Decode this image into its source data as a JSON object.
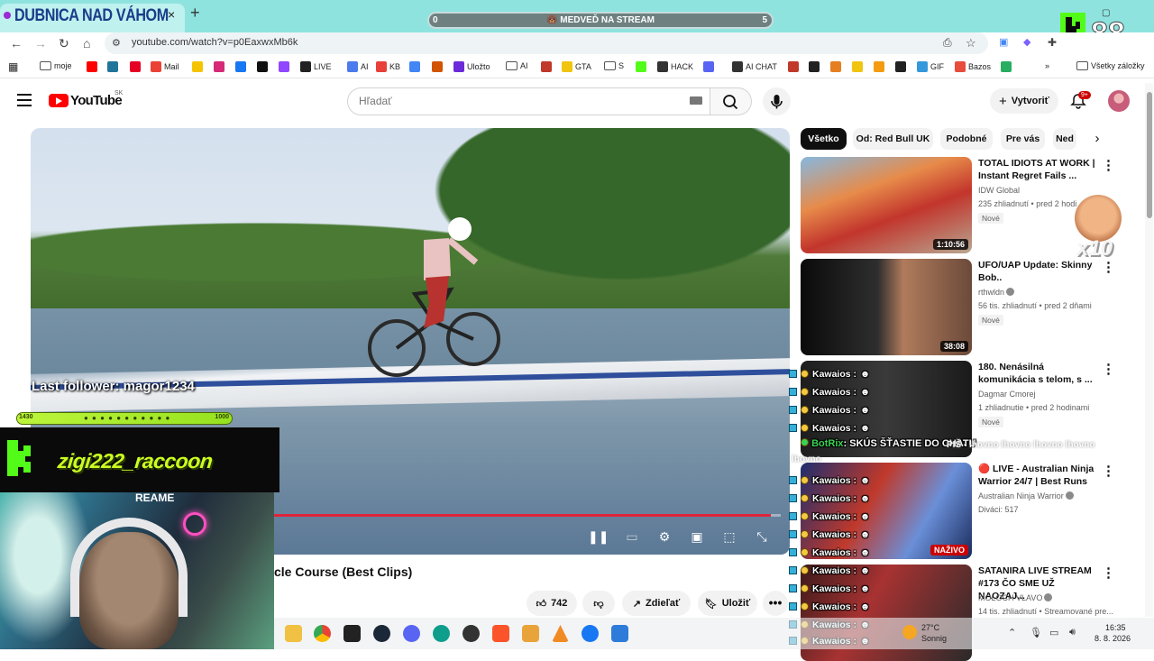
{
  "browser": {
    "tab_title": "DUBNICA NAD VÁHOM",
    "tab_close": "×",
    "new_tab": "+",
    "url": "youtube.com/watch?v=p0EaxwxMb6k",
    "stream_overlay": {
      "left": "0",
      "center": "🐻 MEDVEĎ NA STREAM",
      "right": "5"
    },
    "bookmarks": [
      {
        "label": "moje",
        "icon": "folder-icon",
        "color": "#555555"
      },
      {
        "label": "",
        "icon": "youtube-icon",
        "color": "#ff0000"
      },
      {
        "label": "",
        "icon": "wordpress-icon",
        "color": "#21759b"
      },
      {
        "label": "",
        "icon": "pinterest-icon",
        "color": "#e60023"
      },
      {
        "label": "Mail",
        "icon": "gmail-icon",
        "color": "#ea4335"
      },
      {
        "label": "",
        "icon": "bulb-icon",
        "color": "#f5c400"
      },
      {
        "label": "",
        "icon": "instagram-icon",
        "color": "#d62976"
      },
      {
        "label": "",
        "icon": "facebook-icon",
        "color": "#1877f2"
      },
      {
        "label": "",
        "icon": "tiktok-icon",
        "color": "#111111"
      },
      {
        "label": "",
        "icon": "twitch-icon",
        "color": "#9146ff"
      },
      {
        "label": "LIVE",
        "icon": "live-icon",
        "color": "#222222"
      },
      {
        "label": "AI",
        "icon": "gemini-icon",
        "color": "#4b7bec"
      },
      {
        "label": "KB",
        "icon": "kb-icon",
        "color": "#e8403a"
      },
      {
        "label": "",
        "icon": "translate-icon",
        "color": "#4285f4"
      },
      {
        "label": "",
        "icon": "app-icon",
        "color": "#d35400"
      },
      {
        "label": "Uložto",
        "icon": "ulozto-icon",
        "color": "#6c2bd9"
      },
      {
        "label": "AI",
        "icon": "folder-icon",
        "color": "#555555"
      },
      {
        "label": "",
        "icon": "app-icon",
        "color": "#c0392b"
      },
      {
        "label": "GTA",
        "icon": "gta-icon",
        "color": "#f1c40f"
      },
      {
        "label": "S",
        "icon": "folder-icon",
        "color": "#555555"
      },
      {
        "label": "",
        "icon": "kick-icon",
        "color": "#53fc18"
      },
      {
        "label": "HACK",
        "icon": "hack-icon",
        "color": "#333333"
      },
      {
        "label": "",
        "icon": "discord-icon",
        "color": "#5865f2"
      },
      {
        "label": "AI CHAT",
        "icon": "chat-icon",
        "color": "#333333"
      },
      {
        "label": "",
        "icon": "dots-icon",
        "color": "#c0392b"
      },
      {
        "label": "",
        "icon": "globe-icon",
        "color": "#222222"
      },
      {
        "label": "",
        "icon": "app-icon",
        "color": "#e67e22"
      },
      {
        "label": "",
        "icon": "app-icon",
        "color": "#f1c40f"
      },
      {
        "label": "",
        "icon": "app-icon",
        "color": "#f39c12"
      },
      {
        "label": "",
        "icon": "app-icon",
        "color": "#222222"
      },
      {
        "label": "GIF",
        "icon": "gif-icon",
        "color": "#3498db"
      },
      {
        "label": "Bazos",
        "icon": "bazos-icon",
        "color": "#e74c3c"
      },
      {
        "label": "",
        "icon": "app-icon",
        "color": "#27ae60"
      }
    ],
    "bookmarks_more": "»",
    "all_bookmarks": "Všetky záložky"
  },
  "youtube": {
    "logo_text": "YouTube",
    "region": "SK",
    "search_placeholder": "Hľadať",
    "create_label": "Vytvoriť",
    "notif_count": "9+",
    "video_title": "cle Course (Best Clips)",
    "like_count": "742",
    "share_label": "Zdieľať",
    "save_label": "Uložiť",
    "more_label": "•••",
    "progress": 0.98,
    "chips": [
      "Všetko",
      "Od: Red Bull UK",
      "Podobné",
      "Pre vás",
      "Ned"
    ],
    "recommendations": [
      {
        "title": "TOTAL IDIOTS AT WORK | Instant Regret Fails ...",
        "channel": "IDW Global",
        "meta": "235 zhliadnutí • pred 2 hodi",
        "badge": "Nové",
        "duration": "1:10:56",
        "verified": false,
        "live": false
      },
      {
        "title": "UFO/UAP Update: Skinny Bob..",
        "channel": "rthwldn",
        "meta": "56 tis. zhliadnutí • pred 2 dňami",
        "badge": "Nové",
        "duration": "38:08",
        "verified": true,
        "live": false
      },
      {
        "title": "180. Nenásilná komunikácia s telom, s ...",
        "channel": "Dagmar Cmorej",
        "meta": "1 zhliadnutie • pred 2 hodinami",
        "badge": "Nové",
        "duration": "",
        "verified": false,
        "live": false
      },
      {
        "title": "🔴 LIVE - Australian Ninja Warrior 24/7 | Best Runs",
        "channel": "Australian Ninja Warrior",
        "meta": "Diváci: 517",
        "badge": "",
        "duration": "NAŽIVO",
        "verified": true,
        "live": true
      },
      {
        "title": "SATANIRA LIVE STREAM #173 ČO SME UŽ NAOZAJ...",
        "channel": "MOLOCH VLAVO",
        "meta": "14 tis. zhliadnutí • Streamované pre...",
        "badge": "",
        "duration": "",
        "verified": true,
        "live": false
      }
    ]
  },
  "overlay": {
    "last_follower": "Last follower: magor1234",
    "strip_num": "1430",
    "strip_right": "1000",
    "streamer_name": "zigi222_raccoon",
    "webcam_label": "REAME",
    "bot_name": "BotRix",
    "bot_message": ": SKÚS ŠŤASTIE DO CHATU",
    "chat_ghost": "PIŠ - lhovno lhovno lhovno lhovno",
    "chat_ghost2": "lhovno",
    "chat_user": "Kawaios :",
    "emoji_multiplier": "x10"
  },
  "taskbar": {
    "temp": "27°C",
    "weather": "Sonnig",
    "time": "16:35",
    "date": "8. 8. 2026"
  }
}
